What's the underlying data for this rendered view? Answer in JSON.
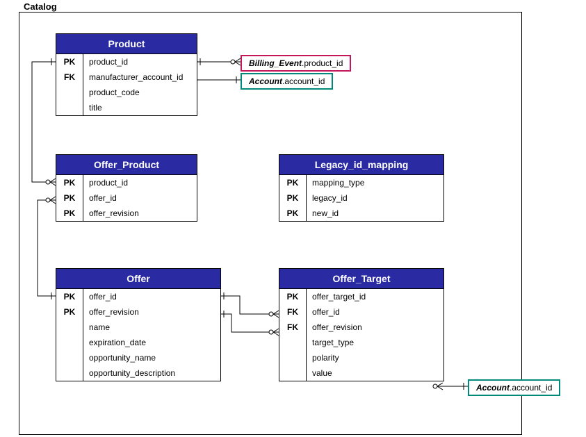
{
  "module": {
    "label": "Catalog"
  },
  "entities": {
    "product": {
      "title": "Product",
      "rows": [
        {
          "key": "PK",
          "name": "product_id"
        },
        {
          "key": "FK",
          "name": "manufacturer_account_id"
        },
        {
          "key": "",
          "name": "product_code"
        },
        {
          "key": "",
          "name": "title"
        }
      ]
    },
    "offer_product": {
      "title": "Offer_Product",
      "rows": [
        {
          "key": "PK",
          "name": "product_id"
        },
        {
          "key": "PK",
          "name": "offer_id"
        },
        {
          "key": "PK",
          "name": "offer_revision"
        }
      ]
    },
    "legacy": {
      "title": "Legacy_id_mapping",
      "rows": [
        {
          "key": "PK",
          "name": "mapping_type"
        },
        {
          "key": "PK",
          "name": "legacy_id"
        },
        {
          "key": "PK",
          "name": "new_id"
        }
      ]
    },
    "offer": {
      "title": "Offer",
      "rows": [
        {
          "key": "PK",
          "name": "offer_id"
        },
        {
          "key": "PK",
          "name": "offer_revision"
        },
        {
          "key": "",
          "name": "name"
        },
        {
          "key": "",
          "name": "expiration_date"
        },
        {
          "key": "",
          "name": "opportunity_name"
        },
        {
          "key": "",
          "name": "opportunity_description"
        }
      ]
    },
    "offer_target": {
      "title": "Offer_Target",
      "rows": [
        {
          "key": "PK",
          "name": "offer_target_id"
        },
        {
          "key": "FK",
          "name": "offer_id"
        },
        {
          "key": "FK",
          "name": "offer_revision"
        },
        {
          "key": "",
          "name": "target_type"
        },
        {
          "key": "",
          "name": "polarity"
        },
        {
          "key": "",
          "name": "value"
        }
      ]
    }
  },
  "refs": {
    "billing": {
      "entity": "Billing_Event",
      "col": ".product_id",
      "color": "#c2185b"
    },
    "account1": {
      "entity": "Account",
      "col": ".account_id",
      "color": "#00897b"
    },
    "account2": {
      "entity": "Account",
      "col": ".account_id",
      "color": "#00897b"
    }
  }
}
